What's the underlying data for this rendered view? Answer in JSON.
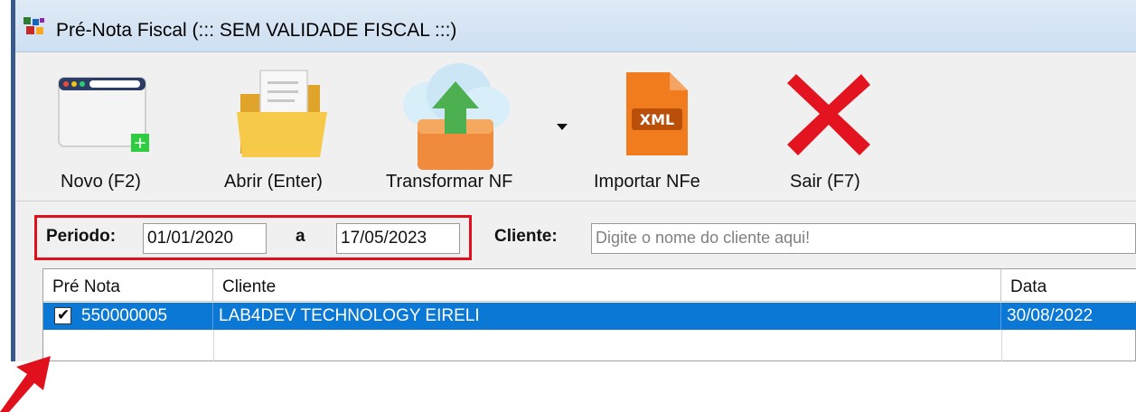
{
  "window": {
    "title": "Pré-Nota Fiscal (::: SEM VALIDADE FISCAL :::)",
    "app_icon": "app-logo-icon"
  },
  "toolbar": {
    "buttons": [
      {
        "label": "Novo (F2)",
        "icon": "new-window-icon"
      },
      {
        "label": "Abrir (Enter)",
        "icon": "folder-open-icon"
      },
      {
        "label": "Transformar NF",
        "icon": "cloud-upload-icon",
        "has_dropdown": true
      },
      {
        "label": "Importar NFe",
        "icon": "xml-file-icon"
      },
      {
        "label": "Sair (F7)",
        "icon": "close-x-icon"
      }
    ]
  },
  "filter": {
    "period_label": "Periodo:",
    "date_from": "01/01/2020",
    "separator": "a",
    "date_to": "17/05/2023",
    "client_label": "Cliente:",
    "client_placeholder": "Digite o nome do cliente aqui!"
  },
  "grid": {
    "columns": [
      "Pré Nota",
      "Cliente",
      "Data"
    ],
    "rows": [
      {
        "checked": true,
        "pre_nota": "550000005",
        "cliente": "LAB4DEV TECHNOLOGY EIRELI",
        "data": "30/08/2022"
      }
    ]
  },
  "colors": {
    "selection": "#0a78d4",
    "highlight_border": "#e0101c",
    "annotation_arrow": "#e0101c"
  }
}
